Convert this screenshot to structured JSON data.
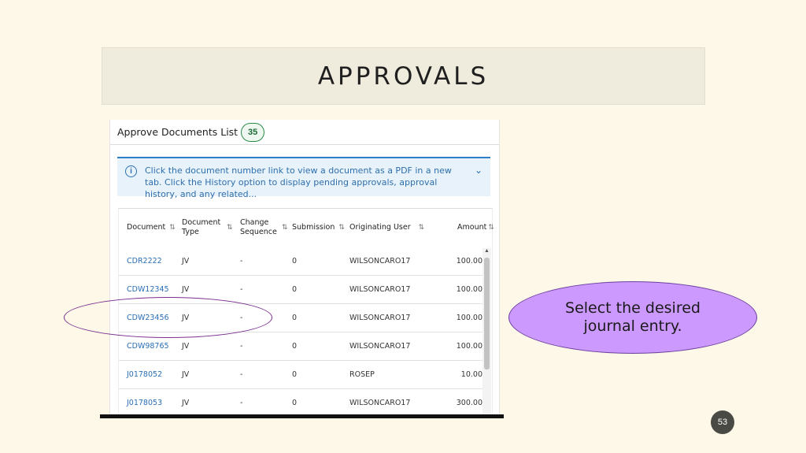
{
  "slide": {
    "title": "APPROVALS",
    "callout": "Select the desired journal entry.",
    "page_number": "53"
  },
  "list": {
    "title": "Approve Documents List",
    "count": "35",
    "info": "Click the document number link to view a document as a PDF in a new tab. Click the History option to display pending approvals, approval history, and any related...",
    "columns": [
      {
        "label": "Document"
      },
      {
        "label": "Document Type"
      },
      {
        "label": "Change Sequence"
      },
      {
        "label": "Submission"
      },
      {
        "label": "Originating User"
      },
      {
        "label": "Amount"
      }
    ],
    "rows": [
      {
        "document": "CDR2222",
        "type": "JV",
        "change": "-",
        "submission": "0",
        "user": "WILSONCARO17",
        "amount": "100.00"
      },
      {
        "document": "CDW12345",
        "type": "JV",
        "change": "-",
        "submission": "0",
        "user": "WILSONCARO17",
        "amount": "100.00"
      },
      {
        "document": "CDW23456",
        "type": "JV",
        "change": "-",
        "submission": "0",
        "user": "WILSONCARO17",
        "amount": "100.00"
      },
      {
        "document": "CDW98765",
        "type": "JV",
        "change": "-",
        "submission": "0",
        "user": "WILSONCARO17",
        "amount": "100.00"
      },
      {
        "document": "J0178052",
        "type": "JV",
        "change": "-",
        "submission": "0",
        "user": "ROSEP",
        "amount": "10.00"
      },
      {
        "document": "J0178053",
        "type": "JV",
        "change": "-",
        "submission": "0",
        "user": "WILSONCARO17",
        "amount": "300.00"
      }
    ]
  },
  "icons": {
    "info": "info-circle-icon",
    "expand": "chevron-down-icon",
    "sort": "sort-updown-icon"
  },
  "colors": {
    "link": "#2a6eb6",
    "badge_border": "#2a8a4a",
    "callout_fill": "#cc99ff",
    "highlight": "#7a2e8e"
  }
}
